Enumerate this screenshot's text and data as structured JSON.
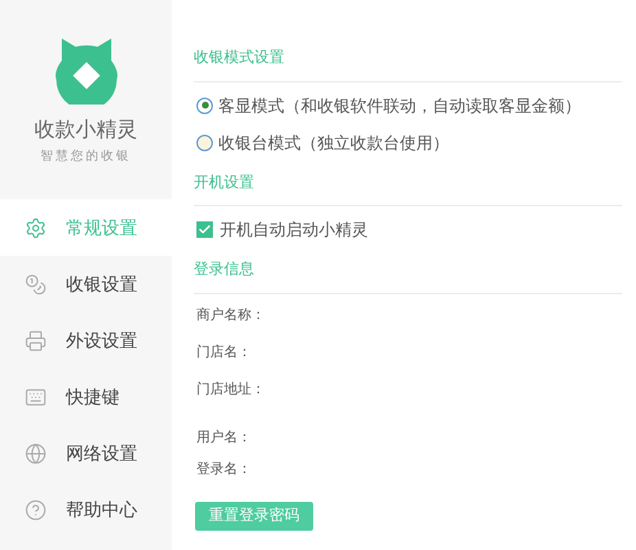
{
  "app": {
    "name": "收款小精灵",
    "tagline": "智慧您的收银"
  },
  "sidebar": {
    "items": [
      {
        "label": "常规设置",
        "selected": true
      },
      {
        "label": "收银设置",
        "selected": false
      },
      {
        "label": "外设设置",
        "selected": false
      },
      {
        "label": "快捷键",
        "selected": false
      },
      {
        "label": "网络设置",
        "selected": false
      },
      {
        "label": "帮助中心",
        "selected": false
      }
    ]
  },
  "cashier_mode": {
    "title": "收银模式设置",
    "options": [
      {
        "label": "客显模式（和收银软件联动，自动读取客显金额）",
        "selected": true
      },
      {
        "label": "收银台模式（独立收款台使用）",
        "selected": false
      }
    ]
  },
  "startup": {
    "title": "开机设置",
    "options": [
      {
        "label": "开机自动启动小精灵",
        "checked": true
      }
    ]
  },
  "login_info": {
    "title": "登录信息",
    "store_fields": [
      "商户名称：",
      "门店名：",
      "门店地址："
    ],
    "user_fields": [
      "用户名：",
      "登录名："
    ],
    "reset_button": "重置登录密码"
  }
}
